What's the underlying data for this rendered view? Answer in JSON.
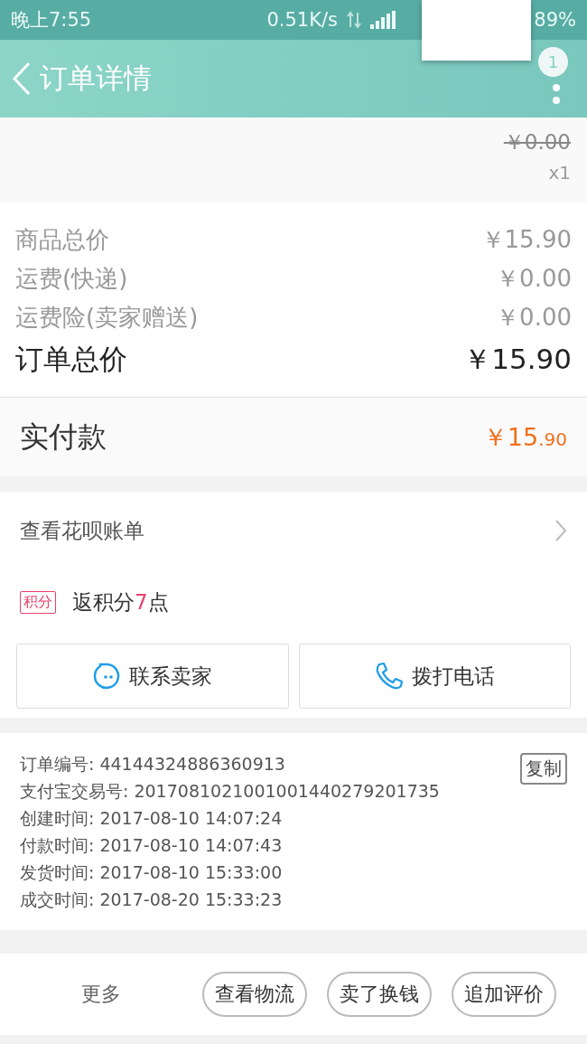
{
  "status_bar": {
    "time": "晚上7:55",
    "speed": "0.51K/s",
    "battery": "89%"
  },
  "header": {
    "title": "订单详情",
    "badge": "1"
  },
  "item": {
    "strike_price": "￥0.00",
    "quantity": "x1"
  },
  "summary": [
    {
      "label": "商品总价",
      "value": "￥15.90",
      "kind": "normal"
    },
    {
      "label": "运费(快递)",
      "value": "￥0.00",
      "kind": "normal"
    },
    {
      "label": "运费险(卖家赠送)",
      "value": "￥0.00",
      "kind": "normal"
    },
    {
      "label": "订单总价",
      "value": "￥15.90",
      "kind": "total"
    }
  ],
  "paid": {
    "label": "实付款",
    "amount_main": "￥15",
    "amount_cents": ".90"
  },
  "huabei": {
    "label": "查看花呗账单"
  },
  "points": {
    "tag": "积分",
    "prefix": "返积分",
    "number": "7",
    "suffix": "点"
  },
  "contact_buttons": [
    {
      "label": "联系卖家",
      "kind": "chat"
    },
    {
      "label": "拨打电话",
      "kind": "phone"
    }
  ],
  "order_info": {
    "copy_button": "复制",
    "lines": [
      "订单编号: 44144324886360913",
      "支付宝交易号: 2017081021001001440279201735",
      "创建时间: 2017-08-10 14:07:24",
      "付款时间: 2017-08-10 14:07:43",
      "发货时间: 2017-08-10 15:33:00",
      "成交时间: 2017-08-20 15:33:23"
    ]
  },
  "bottom_bar": {
    "more": "更多",
    "buttons": [
      "查看物流",
      "卖了换钱",
      "追加评价"
    ]
  }
}
